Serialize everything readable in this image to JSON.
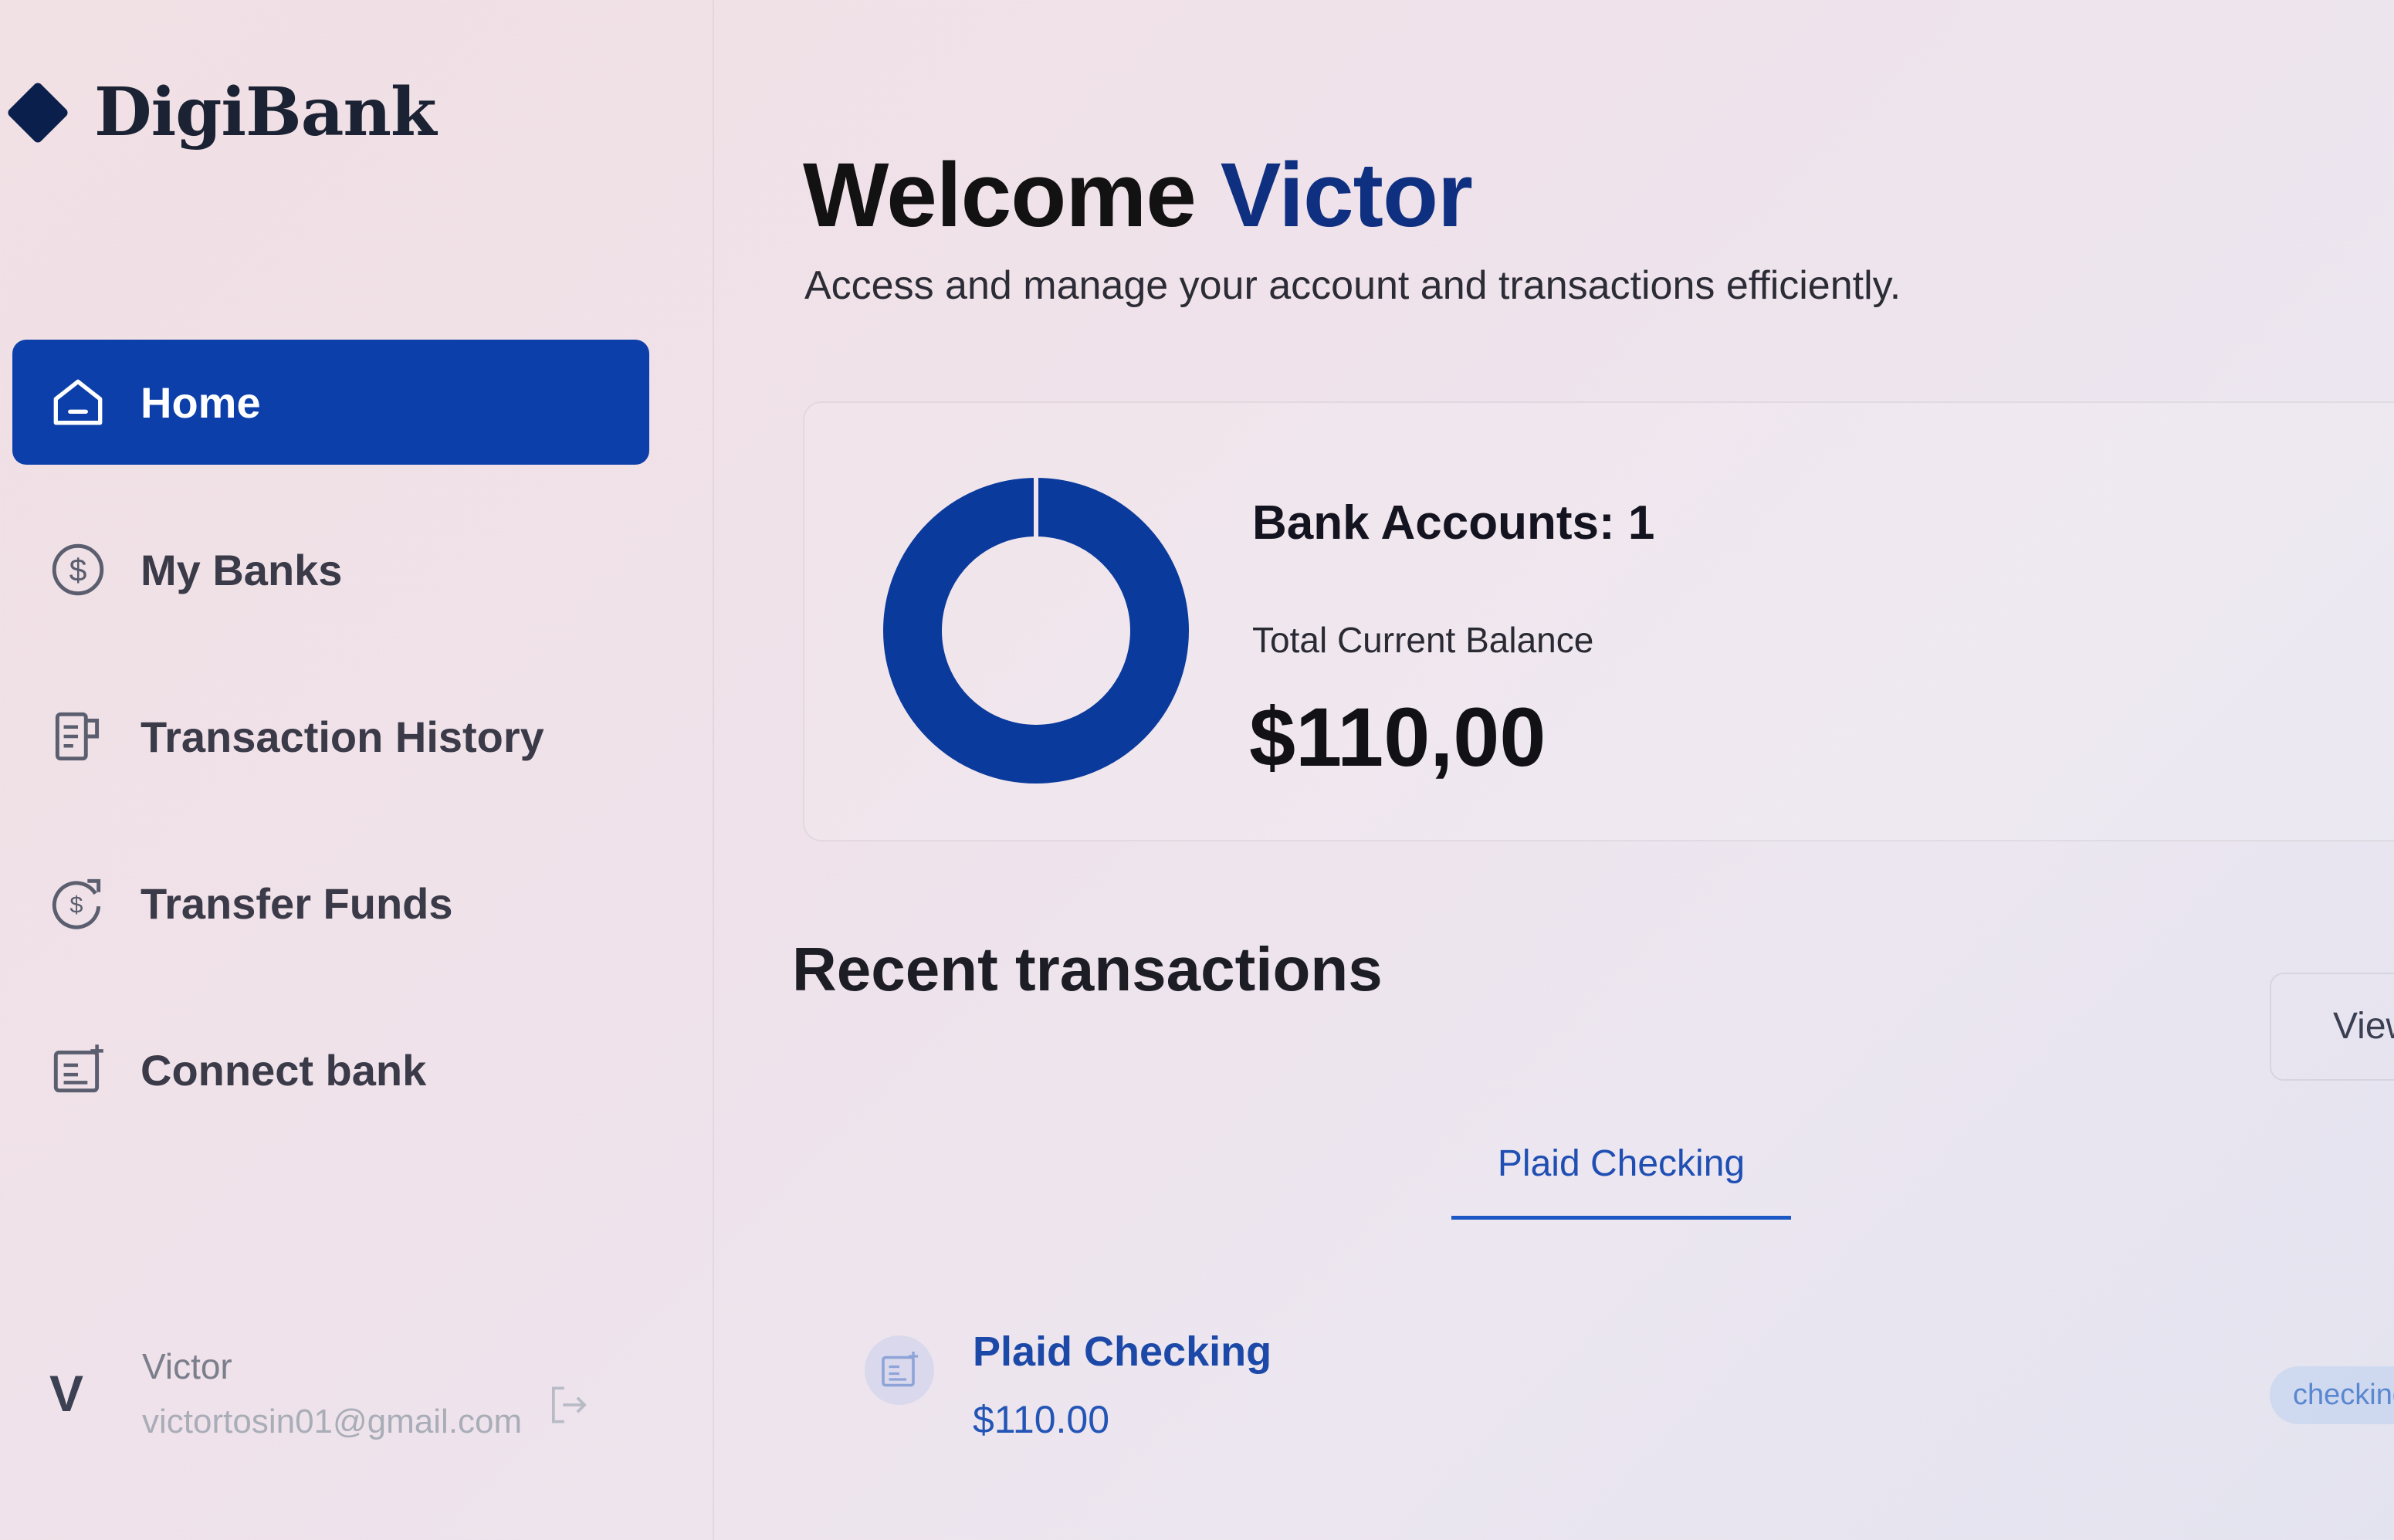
{
  "app": {
    "logo_text": "DigiBank"
  },
  "sidebar": {
    "items": [
      {
        "label": "Home",
        "icon": "home-icon",
        "active": true
      },
      {
        "label": "My Banks",
        "icon": "dollar-circle-icon",
        "active": false
      },
      {
        "label": "Transaction History",
        "icon": "receipt-icon",
        "active": false
      },
      {
        "label": "Transfer Funds",
        "icon": "transfer-icon",
        "active": false
      },
      {
        "label": "Connect bank",
        "icon": "connect-bank-icon",
        "active": false
      }
    ],
    "user": {
      "initial": "V",
      "name": "Victor",
      "email": "victortosin01@gmail.com",
      "logout_icon": "logout-icon"
    }
  },
  "header": {
    "welcome_prefix": "Welcome",
    "user_name": "Victor",
    "subtitle": "Access and manage your account and transactions efficiently."
  },
  "balance": {
    "accounts_label": "Bank Accounts: 1",
    "total_label": "Total Current Balance",
    "total_value": "$110,00"
  },
  "recent": {
    "title": "Recent transactions",
    "view_all_label": "View",
    "tabs": [
      {
        "label": "Plaid Checking",
        "active": true
      }
    ],
    "transactions": [
      {
        "name": "Plaid Checking",
        "amount": "$110.00",
        "badge": "checking"
      }
    ]
  },
  "colors": {
    "primary": "#0c3fa9",
    "brand_dark": "#0f2f80",
    "donut": "#0a3a9c",
    "link_blue": "#1c49a8"
  }
}
